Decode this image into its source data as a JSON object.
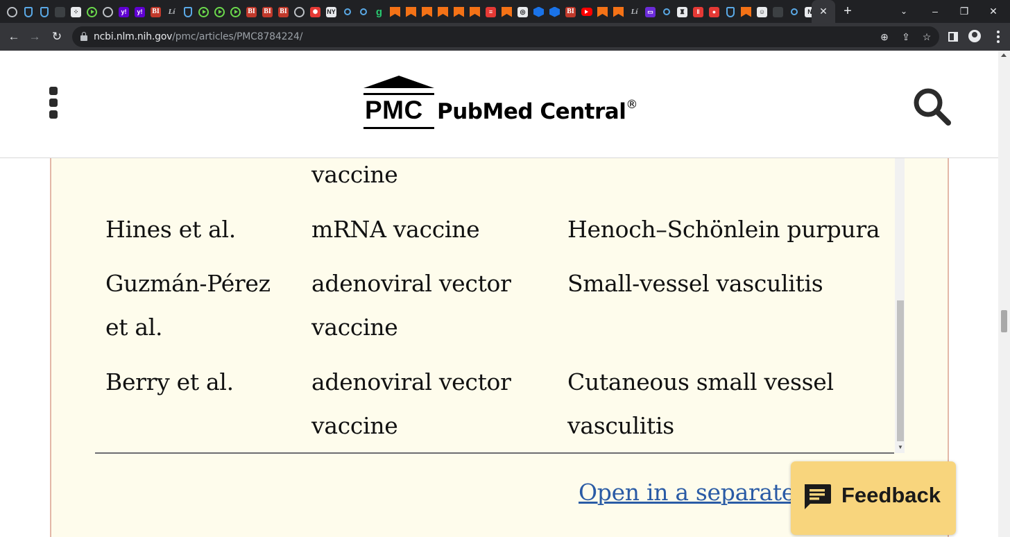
{
  "browser": {
    "favicon_tabs": [
      {
        "icon": "globe-icon",
        "style": "ring",
        "glyph": ""
      },
      {
        "icon": "shield-icon",
        "style": "shield",
        "glyph": ""
      },
      {
        "icon": "shield-icon",
        "style": "shield",
        "glyph": ""
      },
      {
        "icon": "bookmark-icon",
        "style": "dark",
        "glyph": ""
      },
      {
        "icon": "puzzle-icon",
        "style": "white",
        "glyph": "⁘"
      },
      {
        "icon": "play-icon",
        "style": "play",
        "glyph": ""
      },
      {
        "icon": "globe-icon",
        "style": "ring",
        "glyph": ""
      },
      {
        "icon": "yahoo-icon",
        "style": "yahoo",
        "glyph": "y!"
      },
      {
        "icon": "yahoo-icon",
        "style": "yahoo",
        "glyph": "y!"
      },
      {
        "icon": "business-insider-icon",
        "style": "bi",
        "glyph": "BI"
      },
      {
        "icon": "lit-icon",
        "style": "ltext",
        "glyph": "Lí"
      },
      {
        "icon": "shield-icon",
        "style": "shield",
        "glyph": ""
      },
      {
        "icon": "play-icon",
        "style": "play",
        "glyph": ""
      },
      {
        "icon": "play-icon",
        "style": "play",
        "glyph": ""
      },
      {
        "icon": "play-icon",
        "style": "play",
        "glyph": ""
      },
      {
        "icon": "business-insider-icon",
        "style": "bi",
        "glyph": "BI"
      },
      {
        "icon": "business-insider-icon",
        "style": "bi",
        "glyph": "BI"
      },
      {
        "icon": "business-insider-icon",
        "style": "bi",
        "glyph": "BI"
      },
      {
        "icon": "globe-icon",
        "style": "ring",
        "glyph": ""
      },
      {
        "icon": "burst-icon",
        "style": "red",
        "glyph": "✺"
      },
      {
        "icon": "news-icon",
        "style": "white",
        "glyph": "NY"
      },
      {
        "icon": "search-icon",
        "style": "search",
        "glyph": ""
      },
      {
        "icon": "search-icon",
        "style": "search",
        "glyph": ""
      },
      {
        "icon": "grammarly-icon",
        "style": "green-g",
        "glyph": "g"
      },
      {
        "icon": "bookmark-flag-icon",
        "style": "flag",
        "glyph": ""
      },
      {
        "icon": "bookmark-flag-icon",
        "style": "flag",
        "glyph": ""
      },
      {
        "icon": "bookmark-flag-icon",
        "style": "flag",
        "glyph": ""
      },
      {
        "icon": "bookmark-flag-icon",
        "style": "flag",
        "glyph": ""
      },
      {
        "icon": "bookmark-flag-icon",
        "style": "flag",
        "glyph": ""
      },
      {
        "icon": "bookmark-flag-icon",
        "style": "flag",
        "glyph": ""
      },
      {
        "icon": "flag-stripes-icon",
        "style": "red",
        "glyph": "≡"
      },
      {
        "icon": "bookmark-flag-icon",
        "style": "flag",
        "glyph": ""
      },
      {
        "icon": "seal-icon",
        "style": "white",
        "glyph": "◎"
      },
      {
        "icon": "hex-icon",
        "style": "hex",
        "glyph": ""
      },
      {
        "icon": "hex-icon",
        "style": "hex",
        "glyph": ""
      },
      {
        "icon": "business-insider-icon",
        "style": "bi",
        "glyph": "BI"
      },
      {
        "icon": "youtube-icon",
        "style": "yt",
        "glyph": ""
      },
      {
        "icon": "shield-orange-icon",
        "style": "flag",
        "glyph": ""
      },
      {
        "icon": "shield-orange-icon",
        "style": "flag",
        "glyph": ""
      },
      {
        "icon": "lit-icon",
        "style": "ltext",
        "glyph": "Lí"
      },
      {
        "icon": "tv-icon",
        "style": "purple",
        "glyph": "▭"
      },
      {
        "icon": "search-icon",
        "style": "search",
        "glyph": ""
      },
      {
        "icon": "crest-icon",
        "style": "white",
        "glyph": "♜"
      },
      {
        "icon": "columns-icon",
        "style": "red",
        "glyph": "‖"
      },
      {
        "icon": "pin-icon",
        "style": "red",
        "glyph": "●"
      },
      {
        "icon": "shield-icon",
        "style": "shield",
        "glyph": ""
      },
      {
        "icon": "bookmark-flag-icon",
        "style": "flag",
        "glyph": ""
      },
      {
        "icon": "portrait-icon",
        "style": "white",
        "glyph": "☺"
      },
      {
        "icon": "bookmark-icon",
        "style": "dark",
        "glyph": ""
      },
      {
        "icon": "search-icon",
        "style": "search",
        "glyph": ""
      },
      {
        "icon": "news-icon",
        "style": "white",
        "glyph": "N"
      },
      {
        "icon": "mail-icon",
        "style": "purple",
        "glyph": "✉"
      }
    ],
    "active_tab_close": "✕",
    "new_tab": "+",
    "tab_search": "⌄",
    "window_controls": {
      "minimize": "–",
      "restore": "❐",
      "close": "✕"
    },
    "nav": {
      "back": "←",
      "forward": "→",
      "reload": "↻"
    },
    "url_host": "ncbi.nlm.nih.gov",
    "url_path": "/pmc/articles/PMC8784224/",
    "omnibox_icons": {
      "zoom": "⊕",
      "share": "⇪",
      "bookmark": "☆"
    }
  },
  "header": {
    "logo_mark": "PMC",
    "logo_name": "PubMed Central",
    "logo_registered": "®"
  },
  "table": {
    "rows": [
      {
        "author": "",
        "vaccine": [
          "vaccine"
        ],
        "condition": [
          ""
        ]
      },
      {
        "author": "Hines et al.",
        "vaccine": [
          "mRNA vaccine"
        ],
        "condition": [
          "Henoch–Schönlein purpura"
        ]
      },
      {
        "author_lines": [
          "Guzmán-Pérez",
          "et al."
        ],
        "vaccine": [
          "adenoviral vector",
          "vaccine"
        ],
        "condition": [
          "Small-vessel vasculitis"
        ]
      },
      {
        "author": "Berry et al.",
        "vaccine": [
          "adenoviral vector",
          "vaccine"
        ],
        "condition": [
          "Cutaneous small vessel",
          "vasculitis"
        ]
      }
    ],
    "scroll_down": "▼"
  },
  "open_link": "Open in a separate window",
  "feedback": {
    "label": "Feedback"
  }
}
